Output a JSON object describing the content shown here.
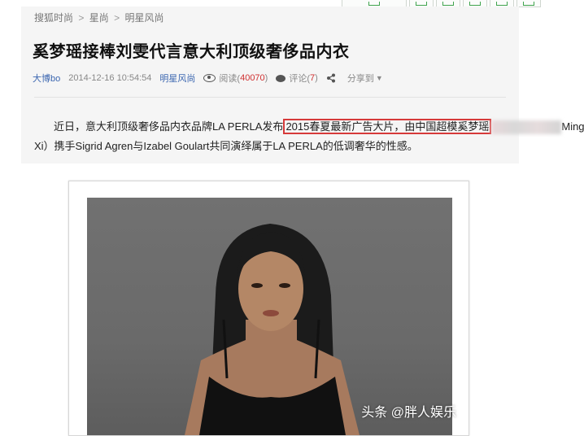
{
  "breadcrumb": [
    "搜狐时尚",
    "星尚",
    "明星风尚"
  ],
  "breadcrumb_sep": ">",
  "article": {
    "title": "奚梦瑶接棒刘雯代言意大利顶级奢侈品内衣",
    "author": "大博bo",
    "datetime": "2014-12-16 10:54:54",
    "channel": "明星风尚",
    "views_label": "阅读(",
    "views_count": "40070",
    "views_close": ")",
    "comments_label": "评论(",
    "comments_count": "7",
    "comments_close": ")",
    "share_label": "分享到",
    "body_line1_prefix": "近日，意大利顶级奢侈品内衣品牌LA PERLA发布",
    "body_line1_highlight": "2015春夏最新广告大片，由中国超模奚梦瑶",
    "body_line1_suffix": "Ming",
    "body_line2": "Xi）携手Sigrid Agren与Izabel Goulart共同演绎属于LA PERLA的低调奢华的性感。"
  },
  "watermark": "头条 @胖人娱乐",
  "colors": {
    "highlight_border": "#d63a3a",
    "link_blue": "#3b66b0",
    "count_red": "#d03030"
  },
  "icons": [
    "eye-icon",
    "comment-icon",
    "share-icon",
    "caret-down-icon"
  ]
}
